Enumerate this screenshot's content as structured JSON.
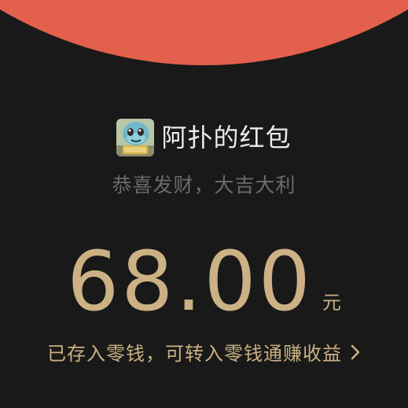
{
  "header": {
    "background_color": "#e2604c"
  },
  "sender": {
    "avatar_icon": "squirtle-avatar-icon",
    "name": "阿扑的红包"
  },
  "blessing": "恭喜发财，大吉大利",
  "amount": {
    "value": "68.00",
    "unit": "元",
    "color": "#cbb183"
  },
  "wallet_note": {
    "text": "已存入零钱，可转入零钱通赚收益",
    "icon": "chevron-right-icon"
  }
}
